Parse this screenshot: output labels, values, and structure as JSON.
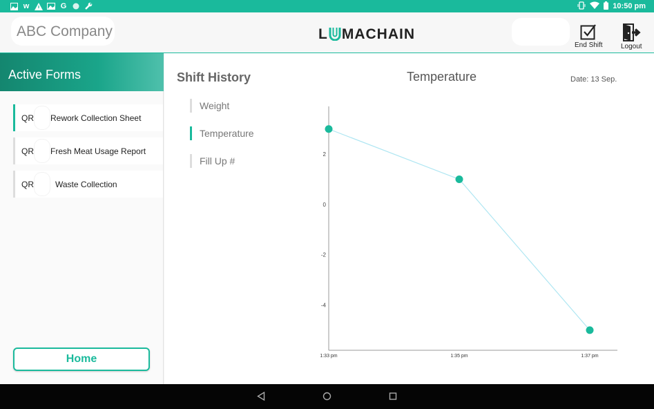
{
  "status_bar": {
    "time": "10:50 pm",
    "left_icons": [
      "image-icon",
      "w-icon",
      "warning-icon",
      "photo-icon",
      "google-icon",
      "circle-icon",
      "wrench-icon"
    ],
    "right_icons": [
      "vibrate-icon",
      "wifi-icon",
      "battery-icon"
    ]
  },
  "header": {
    "company": "ABC Company",
    "brand": {
      "prefix": "L",
      "suffix": "MACHAIN"
    },
    "end_shift_label": "End Shift",
    "logout_label": "Logout"
  },
  "sidebar": {
    "title": "Active Forms",
    "forms": [
      {
        "prefix": "QR-",
        "name": "Rework Collection Sheet",
        "active": true
      },
      {
        "prefix": "QR-",
        "name": "Fresh Meat Usage Report",
        "active": false
      },
      {
        "prefix": "QR-",
        "name": "Waste Collection",
        "active": false
      }
    ],
    "home_label": "Home"
  },
  "main": {
    "title": "Shift History",
    "nav": [
      {
        "label": "Weight",
        "active": false
      },
      {
        "label": "Temperature",
        "active": true
      },
      {
        "label": "Fill Up #",
        "active": false
      }
    ],
    "chart_title": "Temperature",
    "date": "Date: 13 Sep."
  },
  "chart_data": {
    "type": "line",
    "title": "Temperature",
    "categories": [
      "1:33 pm",
      "1:35 pm",
      "1:37 pm"
    ],
    "values": [
      3,
      1,
      -5
    ],
    "y_ticks": [
      2,
      0,
      -2,
      -4
    ],
    "ylim": [
      -5.8,
      3.9
    ],
    "grid": false,
    "line_color": "#aee6f2",
    "point_color": "#1aba9c"
  },
  "colors": {
    "accent": "#1aba9c",
    "status_bar": "#1aba9c",
    "nav_bar": "#050505"
  },
  "nav_bar": {
    "icons": [
      "back-icon",
      "home-icon",
      "recents-icon"
    ]
  }
}
